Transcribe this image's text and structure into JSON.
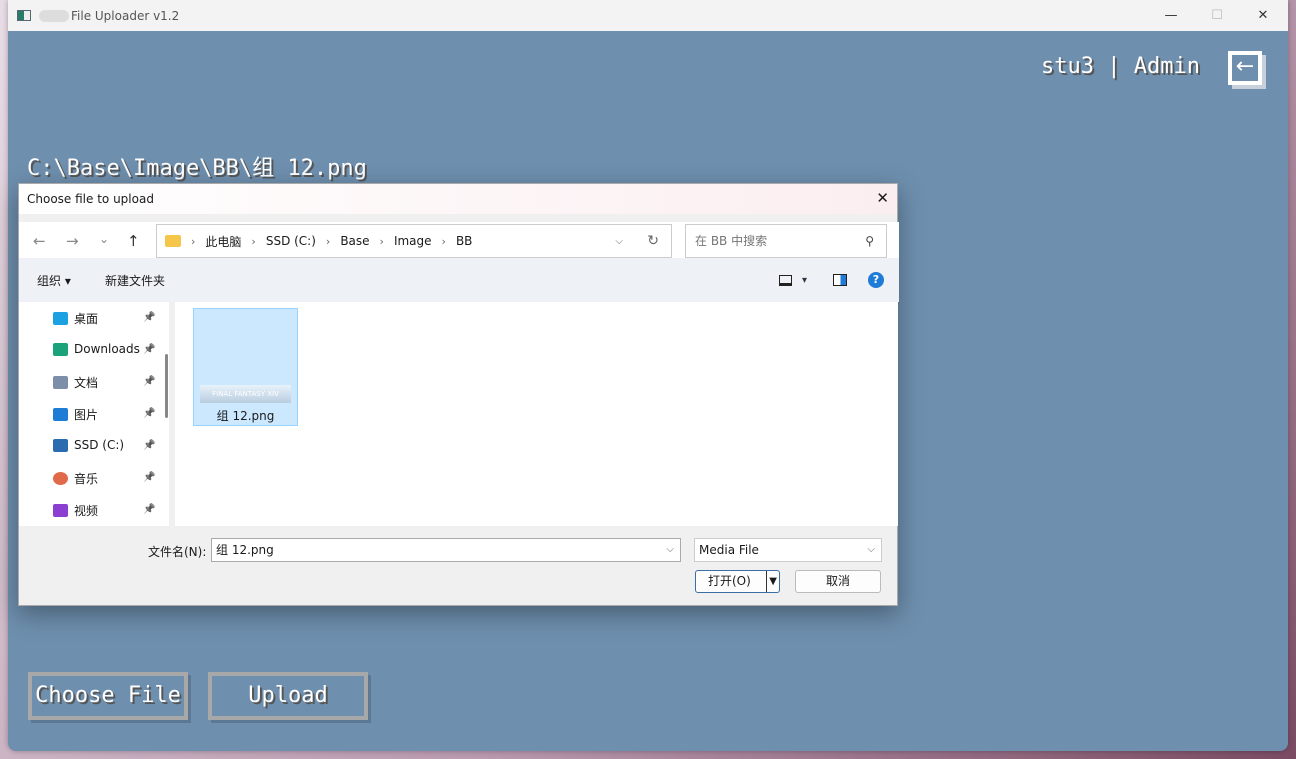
{
  "window": {
    "title": "File Uploader v1.2",
    "minimize": "—",
    "maximize": "☐",
    "close": "✕"
  },
  "header": {
    "user": "stu3 | Admin",
    "logout_icon": "←"
  },
  "main": {
    "selected_path": "C:\\Base\\Image\\BB\\组 12.png",
    "choose_label": "Choose File",
    "upload_label": "Upload"
  },
  "dialog": {
    "title": "Choose file to upload",
    "close": "✕",
    "nav": {
      "back": "←",
      "forward": "→",
      "recent": "⌄",
      "up": "↑"
    },
    "breadcrumb": [
      "此电脑",
      "SSD (C:)",
      "Base",
      "Image",
      "BB"
    ],
    "refresh": "↻",
    "search_placeholder": "在 BB 中搜索",
    "toolbar": {
      "organize": "组织 ▾",
      "new_folder": "新建文件夹",
      "view": "▾",
      "help": "?"
    },
    "sidebar": [
      {
        "label": "桌面",
        "icon": "desktop-icon",
        "color": "#1ba1e2"
      },
      {
        "label": "Downloads",
        "icon": "download-icon",
        "color": "#1aa37a"
      },
      {
        "label": "文档",
        "icon": "document-icon",
        "color": "#7d8fa8"
      },
      {
        "label": "图片",
        "icon": "pictures-icon",
        "color": "#1e7bd6"
      },
      {
        "label": "SSD (C:)",
        "icon": "drive-icon",
        "color": "#2b6cb0"
      },
      {
        "label": "音乐",
        "icon": "music-icon",
        "color": "#e06a4a"
      },
      {
        "label": "视频",
        "icon": "video-icon",
        "color": "#8a3fd1"
      }
    ],
    "files": [
      {
        "name": "组 12.png",
        "thumb_text": "FINAL FANTASY XIV"
      }
    ],
    "filename_label": "文件名(N):",
    "filename_value": "组 12.png",
    "filetype": "Media File",
    "open_label": "打开(O)",
    "cancel_label": "取消"
  }
}
